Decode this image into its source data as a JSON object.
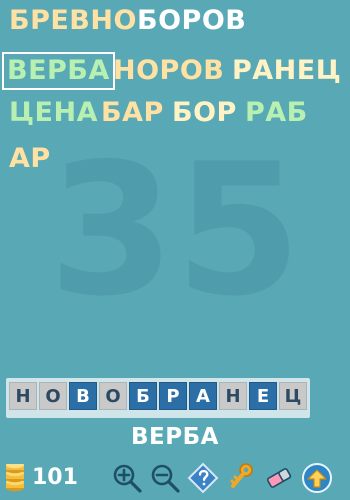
{
  "words": [
    {
      "text": "БРЕВНО",
      "color": "#ffe1a3",
      "selected": false
    },
    {
      "text": "БОРОВ",
      "color": "#ffffff",
      "selected": false
    },
    {
      "text": "ВЕРБА",
      "color": "#b8f0b1",
      "selected": true
    },
    {
      "text": "НОРОВ",
      "color": "#ffe1a3",
      "selected": false
    },
    {
      "text": "РАНЕЦ",
      "color": "#fff3c6",
      "selected": false
    },
    {
      "text": "ЦЕНА",
      "color": "#b8f0b1",
      "selected": false
    },
    {
      "text": "БАР",
      "color": "#ffe1a3",
      "selected": false
    },
    {
      "text": "БОР",
      "color": "#fff3c6",
      "selected": false
    },
    {
      "text": "РАБ",
      "color": "#b8f0b1",
      "selected": false
    },
    {
      "text": "АР",
      "color": "#ffe1a3",
      "selected": false
    }
  ],
  "remaining_count": "35",
  "tiles": [
    {
      "letter": "Н",
      "selected": false
    },
    {
      "letter": "О",
      "selected": false
    },
    {
      "letter": "В",
      "selected": true
    },
    {
      "letter": "О",
      "selected": false
    },
    {
      "letter": "Б",
      "selected": true
    },
    {
      "letter": "Р",
      "selected": true
    },
    {
      "letter": "А",
      "selected": true
    },
    {
      "letter": "Н",
      "selected": false
    },
    {
      "letter": "Е",
      "selected": true
    },
    {
      "letter": "Ц",
      "selected": false
    }
  ],
  "current_word": "ВЕРБА",
  "coins": {
    "value": "101",
    "icon": "coins-icon"
  },
  "tools": [
    {
      "name": "zoom-in-icon"
    },
    {
      "name": "zoom-out-icon"
    },
    {
      "name": "help-icon"
    },
    {
      "name": "key-icon"
    },
    {
      "name": "eraser-icon"
    },
    {
      "name": "up-arrow-icon"
    }
  ]
}
